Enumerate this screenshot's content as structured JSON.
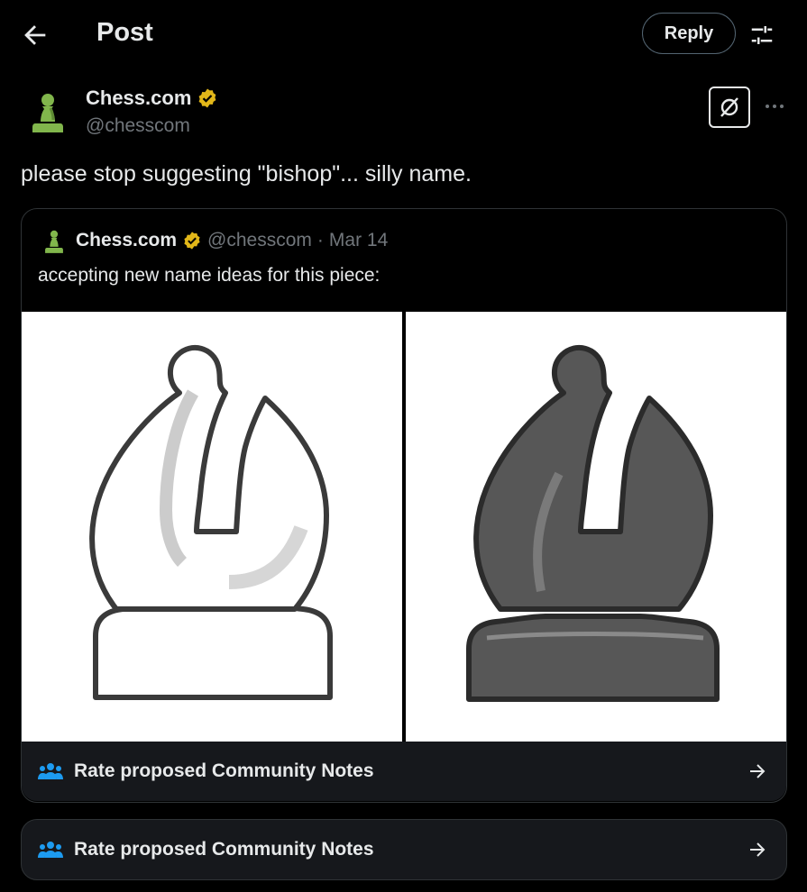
{
  "header": {
    "title": "Post",
    "reply_label": "Reply"
  },
  "post": {
    "author_name": "Chess.com",
    "author_handle": "@chesscom",
    "text": "please stop suggesting \"bishop\"... silly name."
  },
  "quote": {
    "author_name": "Chess.com",
    "author_handle": "@chesscom",
    "separator": "·",
    "date": "Mar 14",
    "text": "accepting new name ideas for this piece:"
  },
  "community_notes": {
    "label_1": "Rate proposed Community Notes",
    "label_2": "Rate proposed Community Notes"
  },
  "icons": {
    "back": "arrow-left-icon",
    "filter": "sliders-icon",
    "verified": "verified-badge-icon",
    "grok": "grok-icon",
    "more": "more-dots-icon",
    "notes": "people-icon",
    "arrow": "arrow-right-icon"
  },
  "colors": {
    "background": "#000000",
    "verified_gold": "#e2b719",
    "notes_blue": "#1d9bf0",
    "pawn_green": "#81b64c"
  }
}
